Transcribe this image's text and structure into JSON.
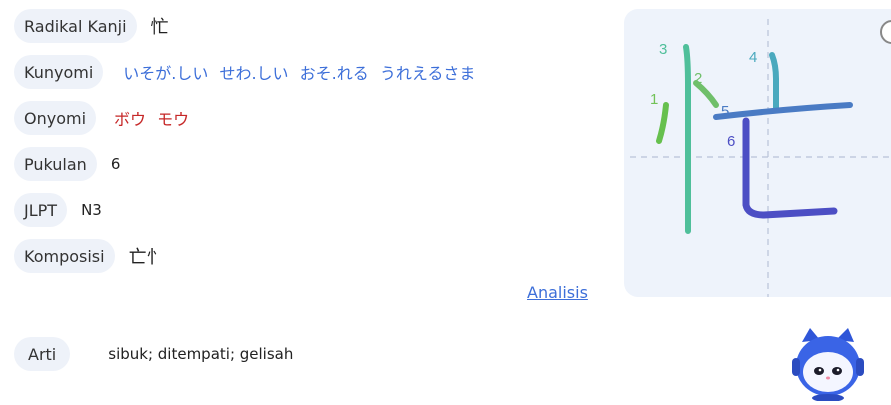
{
  "rows": {
    "radical": {
      "label": "Radikal Kanji",
      "value": "忙"
    },
    "kunyomi": {
      "label": "Kunyomi",
      "values": [
        "いそが.しい",
        "せわ.しい",
        "おそ.れる",
        "うれえるさま"
      ]
    },
    "onyomi": {
      "label": "Onyomi",
      "values": [
        "ボウ",
        "モウ"
      ]
    },
    "pukulan": {
      "label": "Pukulan",
      "value": "6"
    },
    "jlpt": {
      "label": "JLPT",
      "value": "N3"
    },
    "komposisi": {
      "label": "Komposisi",
      "value": "亡忄"
    }
  },
  "analisis_link": "Analisis",
  "arti": {
    "label": "Arti",
    "value": "sibuk; ditempati; gelisah"
  },
  "stroke_numbers": [
    "1",
    "2",
    "3",
    "4",
    "5",
    "6"
  ],
  "colors": {
    "accent_blue": "#3d6fd9",
    "onyomi_red": "#c62828",
    "pill_bg": "#eef2f9",
    "stroke_panel_bg": "#eef3fb"
  },
  "icons": {
    "mascot": "robot-cat-mascot-icon",
    "panel_button": "circle-button-icon"
  }
}
